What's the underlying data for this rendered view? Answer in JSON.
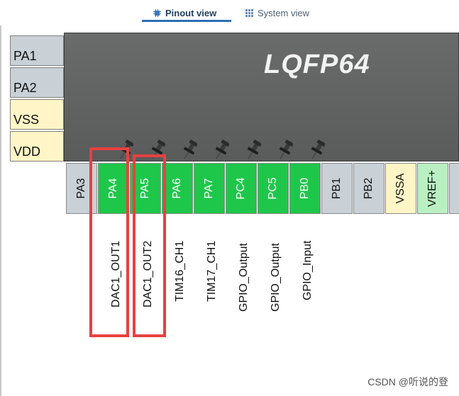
{
  "tabs": {
    "pinout_label": "Pinout view",
    "system_label": "System view"
  },
  "chip": {
    "package": "LQFP64"
  },
  "left_pins": [
    "PA1",
    "PA2",
    "VSS",
    "VDD"
  ],
  "bottom_pins": [
    {
      "name": "PA3",
      "state": "gray",
      "signal": "",
      "pinned": false
    },
    {
      "name": "PA4",
      "state": "green",
      "signal": "DAC1_OUT1",
      "pinned": true
    },
    {
      "name": "PA5",
      "state": "green",
      "signal": "DAC1_OUT2",
      "pinned": true
    },
    {
      "name": "PA6",
      "state": "green",
      "signal": "TIM16_CH1",
      "pinned": true
    },
    {
      "name": "PA7",
      "state": "green",
      "signal": "TIM17_CH1",
      "pinned": true
    },
    {
      "name": "PC4",
      "state": "green",
      "signal": "GPIO_Output",
      "pinned": true
    },
    {
      "name": "PC5",
      "state": "green",
      "signal": "GPIO_Output",
      "pinned": true
    },
    {
      "name": "PB0",
      "state": "green",
      "signal": "GPIO_Input",
      "pinned": true
    },
    {
      "name": "PB1",
      "state": "gray",
      "signal": "",
      "pinned": false
    },
    {
      "name": "PB2",
      "state": "gray",
      "signal": "",
      "pinned": false
    },
    {
      "name": "VSSA",
      "state": "yellow",
      "signal": "",
      "pinned": false
    },
    {
      "name": "VREF+",
      "state": "vgreen",
      "signal": "",
      "pinned": false
    }
  ],
  "colors": {
    "chip_body": "#5f6060",
    "pin_assigned": "#1ec74a",
    "pin_unassigned": "#c9d0d6",
    "pin_power": "#fff5c6",
    "highlight_box": "#e8413f",
    "tab_accent": "#2a6fb8"
  },
  "watermark": "CSDN @听说的登"
}
